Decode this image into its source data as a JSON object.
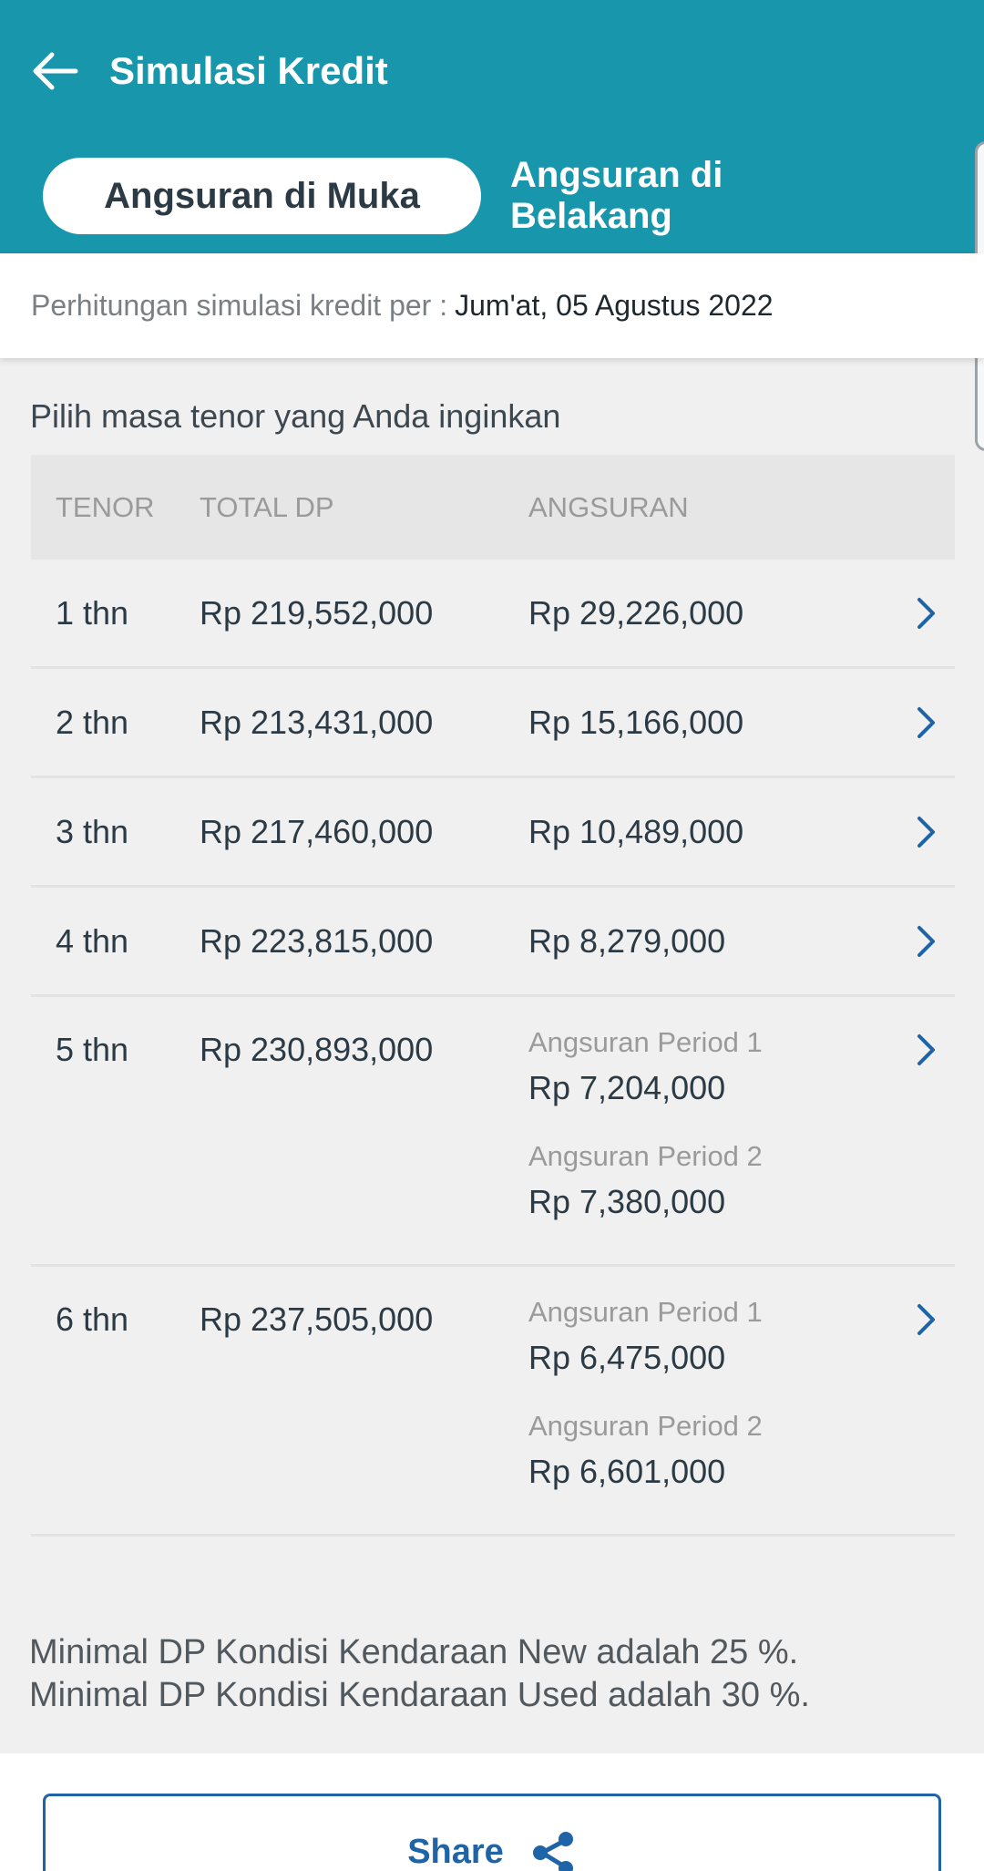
{
  "header": {
    "title": "Simulasi Kredit"
  },
  "tabs": [
    {
      "label": "Angsuran di Muka",
      "active": true
    },
    {
      "label": "Angsuran di Belakang",
      "active": false
    }
  ],
  "date_bar": {
    "label": "Perhitungan simulasi kredit per :",
    "value": "Jum'at, 05 Agustus 2022"
  },
  "section_title": "Pilih masa tenor yang Anda inginkan",
  "table": {
    "headers": {
      "tenor": "TENOR",
      "dp": "TOTAL DP",
      "angsuran": "ANGSURAN"
    },
    "rows": [
      {
        "tenor": "1 thn",
        "dp": "Rp 219,552,000",
        "angsuran": "Rp 29,226,000"
      },
      {
        "tenor": "2 thn",
        "dp": "Rp 213,431,000",
        "angsuran": "Rp 15,166,000"
      },
      {
        "tenor": "3 thn",
        "dp": "Rp 217,460,000",
        "angsuran": "Rp 10,489,000"
      },
      {
        "tenor": "4 thn",
        "dp": "Rp 223,815,000",
        "angsuran": "Rp 8,279,000"
      },
      {
        "tenor": "5 thn",
        "dp": "Rp 230,893,000",
        "period1_label": "Angsuran Period 1",
        "period1_value": "Rp 7,204,000",
        "period2_label": "Angsuran Period 2",
        "period2_value": "Rp 7,380,000"
      },
      {
        "tenor": "6 thn",
        "dp": "Rp 237,505,000",
        "period1_label": "Angsuran Period 1",
        "period1_value": "Rp 6,475,000",
        "period2_label": "Angsuran Period 2",
        "period2_value": "Rp 6,601,000"
      }
    ]
  },
  "notes": [
    "Minimal DP Kondisi Kendaraan New adalah 25 %.",
    "Minimal DP Kondisi Kendaraan Used adalah 30 %."
  ],
  "footer": {
    "share_label": "Share"
  },
  "icons": {
    "back": "arrow-left-icon",
    "row_action": "chevron-right-icon",
    "share": "share-icon"
  },
  "colors": {
    "header_bg": "#1896ab",
    "accent": "#1e64a6",
    "page_bg": "#f0f0f0"
  }
}
